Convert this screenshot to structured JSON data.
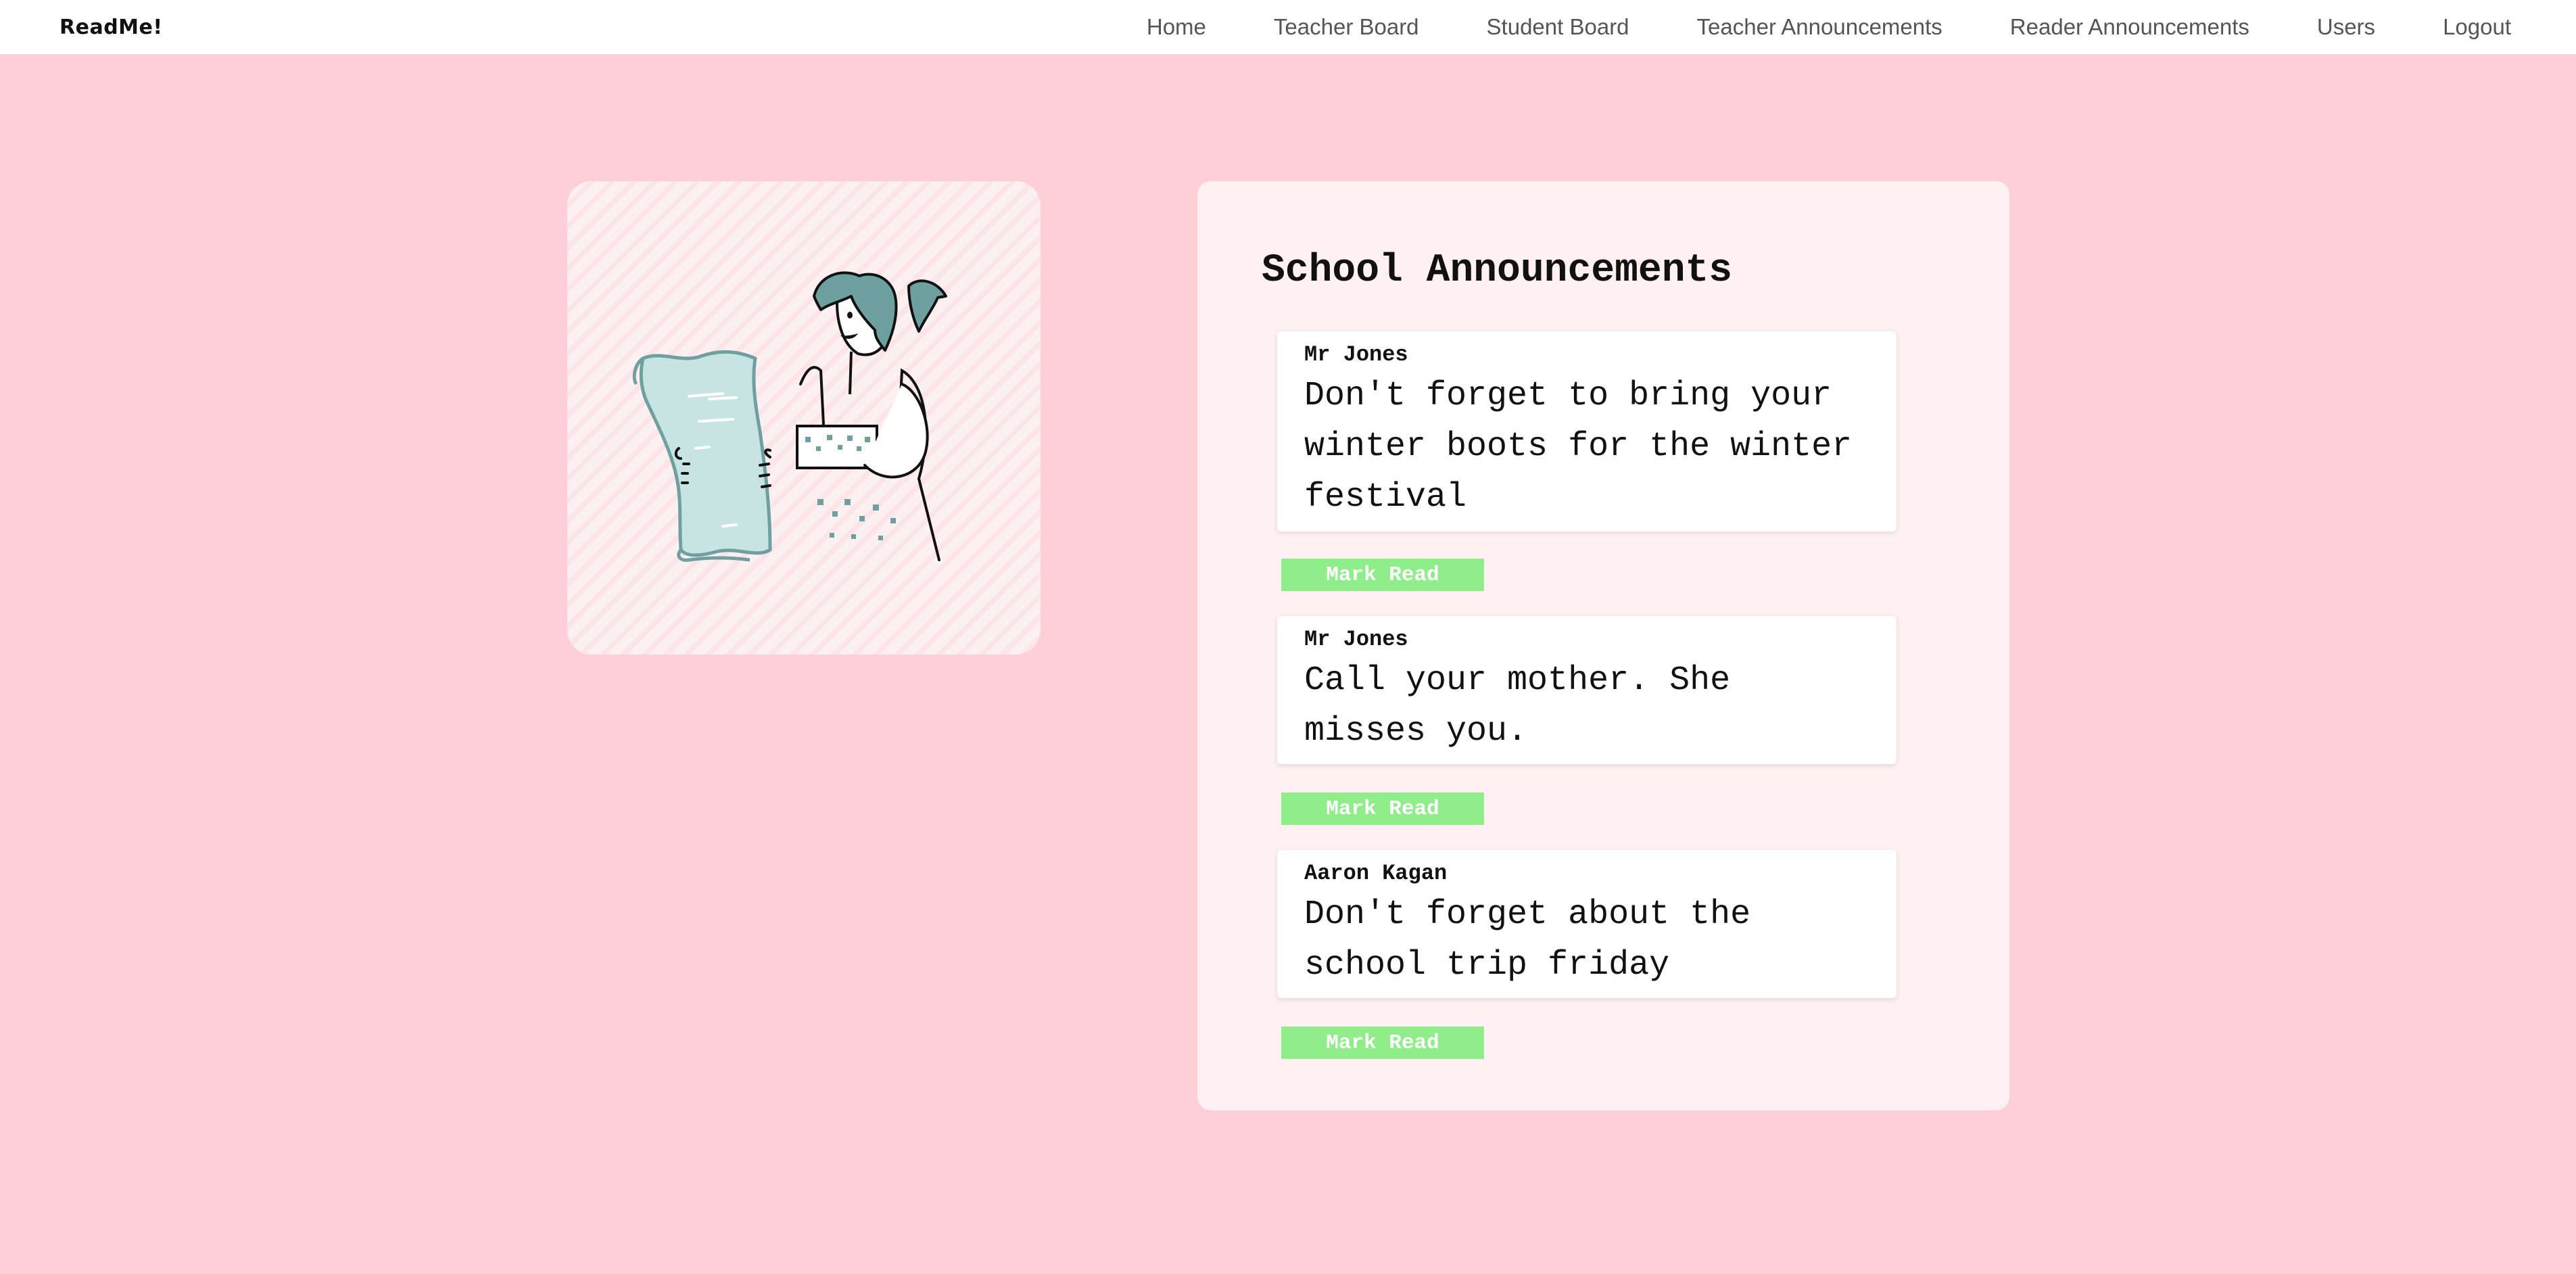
{
  "brand": "ReadMe!",
  "nav": {
    "items": [
      {
        "label": "Home"
      },
      {
        "label": "Teacher Board"
      },
      {
        "label": "Student Board"
      },
      {
        "label": "Teacher Announcements"
      },
      {
        "label": "Reader Announcements"
      },
      {
        "label": "Users"
      },
      {
        "label": "Logout"
      }
    ]
  },
  "illustration": {
    "icon": "girl-reading-scroll-illustration"
  },
  "panel": {
    "title": "School Announcements",
    "announcements": [
      {
        "author": "Mr Jones",
        "message": "Don't forget to bring your winter boots for the winter festival",
        "action_label": "Mark Read"
      },
      {
        "author": "Mr Jones",
        "message": "Call your mother. She misses you.",
        "action_label": "Mark Read"
      },
      {
        "author": "Aaron Kagan",
        "message": "Don't forget about the school trip friday",
        "action_label": "Mark Read"
      }
    ]
  },
  "colors": {
    "page_background": "#ffcfd8",
    "panel_background": "#fff1f3",
    "button_green": "#8fee8a",
    "illustration_teal": "#6fa0a0",
    "scroll_fill": "#c8e4e2"
  }
}
